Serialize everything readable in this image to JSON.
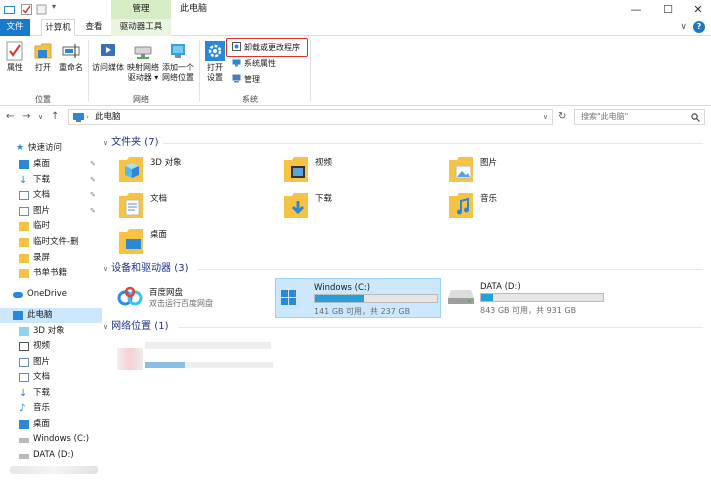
{
  "titlebar": {
    "context_tab": "管理",
    "title": "此电脑",
    "minimize": "—",
    "maximize": "☐",
    "close": "✕"
  },
  "tabs": {
    "file": "文件",
    "computer": "计算机",
    "view": "查看",
    "drive_tools": "驱动器工具",
    "collapse": "∨",
    "help": "?"
  },
  "ribbon": {
    "location_group": {
      "label": "位置",
      "properties": "属性",
      "open": "打开",
      "rename": "重命名"
    },
    "network_group": {
      "label": "网络",
      "access_media": [
        "访问媒体"
      ],
      "map_drive": [
        "映射网络",
        "驱动器"
      ],
      "add_location": [
        "添加一个",
        "网络位置"
      ]
    },
    "system_group": {
      "label": "系统",
      "open_settings": [
        "打开",
        "设置"
      ],
      "uninstall": "卸载或更改程序",
      "system_properties": "系统属性",
      "manage": "管理"
    }
  },
  "address": {
    "path": "此电脑",
    "search_placeholder": "搜索\"此电脑\""
  },
  "sidebar": {
    "quick_access": "快速访问",
    "pinned": [
      {
        "label": "桌面",
        "pinned": true
      },
      {
        "label": "下载",
        "pinned": true
      },
      {
        "label": "文档",
        "pinned": true
      },
      {
        "label": "图片",
        "pinned": true
      },
      {
        "label": "临时",
        "pinned": false
      },
      {
        "label": "临时文件-删",
        "pinned": false
      },
      {
        "label": "录屏",
        "pinned": false
      },
      {
        "label": "书单书籍",
        "pinned": false
      }
    ],
    "onedrive": "OneDrive",
    "this_pc": "此电脑",
    "pc_items": [
      "3D 对象",
      "视频",
      "图片",
      "文档",
      "下载",
      "音乐",
      "桌面",
      "Windows (C:)",
      "DATA (D:)"
    ]
  },
  "content": {
    "folders_header": "文件夹 (7)",
    "folders": [
      "3D 对象",
      "视频",
      "图片",
      "文档",
      "下载",
      "音乐",
      "桌面"
    ],
    "devices_header": "设备和驱动器 (3)",
    "baidu": {
      "name": "百度网盘",
      "sub": "双击运行百度网盘"
    },
    "drive_c": {
      "name": "Windows (C:)",
      "size": "141 GB 可用，共 237 GB",
      "used_fraction": 0.405
    },
    "drive_d": {
      "name": "DATA (D:)",
      "size": "843 GB 可用，共 931 GB",
      "used_fraction": 0.095
    },
    "network_header": "网络位置 (1)"
  },
  "colors": {
    "accent": "#1979ca",
    "selection": "#cce8ff",
    "drive_fill": "#26a0da",
    "highlight": "#e0312b",
    "folder": "#f6c344"
  }
}
